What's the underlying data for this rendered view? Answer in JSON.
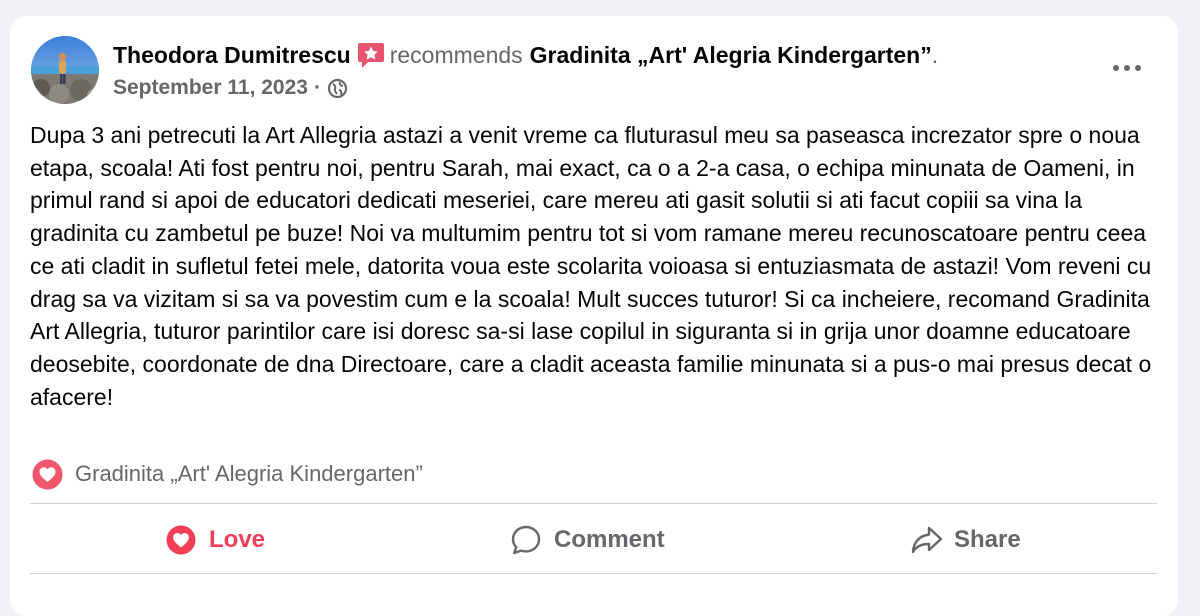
{
  "post": {
    "author": "Theodora Dumitrescu",
    "verb": "recommends",
    "page_name": "Gradinita „Art' Alegria Kindergarten”",
    "page_name_suffix": ".",
    "date": "September 11, 2023",
    "date_separator": "·",
    "audience_icon": "globe-icon",
    "badge_icon": "star-badge-icon",
    "badge_color": "#e8546f",
    "body": "Dupa 3 ani petrecuti la Art Allegria astazi a venit vreme ca fluturasul meu sa paseasca increzator spre o noua etapa, scoala! Ati fost pentru noi, pentru Sarah, mai exact, ca o a 2-a casa, o echipa minunata de Oameni, in primul rand si apoi de educatori dedicati meseriei, care mereu ati gasit solutii si ati facut copiii sa vina la gradinita cu zambetul pe buze! Noi va multumim pentru tot si vom ramane mereu recunoscatoare pentru ceea ce ati cladit in sufletul fetei mele, datorita voua este scolarita voioasa si entuziasmata de astazi! Vom reveni cu drag sa va vizitam si sa va povestim cum e la scoala! Mult succes tuturor! Si ca incheiere, recomand Gradinita Art Allegria, tuturor parintilor care isi doresc sa-si lase copilul in siguranta si in grija unor doamne educatoare deosebite, coordonate de dna Directoare, care a cladit aceasta familie minunata si a pus-o mai presus decat o afacere!",
    "recommendation_label": "Gradinita „Art' Alegria Kindergarten”",
    "recommendation_icon": "heart-badge-icon"
  },
  "actions": {
    "love": "Love",
    "comment": "Comment",
    "share": "Share",
    "love_color": "#f33e58",
    "muted_color": "#65676b"
  }
}
